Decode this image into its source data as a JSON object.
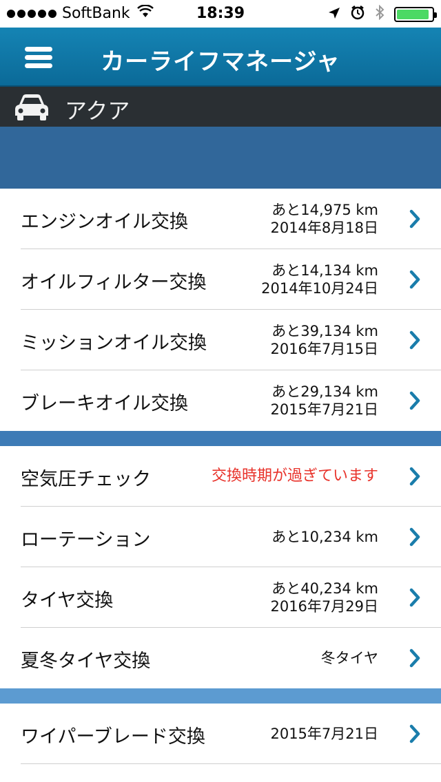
{
  "status": {
    "carrier": "SoftBank",
    "time": "18:39"
  },
  "header": {
    "title": "カーライフマネージャ"
  },
  "car": {
    "name": "アクア"
  },
  "colors": {
    "nav": "#1178a8",
    "car_bar": "#2a2f33",
    "banner": "#31679a",
    "section2": "#3d7bb6",
    "section3": "#5c9bd1",
    "chevron": "#1a7dab",
    "warning": "#e8322a"
  },
  "items": [
    {
      "label": "エンジンオイル交換",
      "line1": "あと14,975 km",
      "line2": "2014年8月18日"
    },
    {
      "label": "オイルフィルター交換",
      "line1": "あと14,134 km",
      "line2": "2014年10月24日"
    },
    {
      "label": "ミッションオイル交換",
      "line1": "あと39,134 km",
      "line2": "2016年7月15日"
    },
    {
      "label": "ブレーキオイル交換",
      "line1": "あと29,134 km",
      "line2": "2015年7月21日"
    },
    {
      "label": "空気圧チェック",
      "warning": "交換時期が過ぎています"
    },
    {
      "label": "ローテーション",
      "line1": "あと10,234 km"
    },
    {
      "label": "タイヤ交換",
      "line1": "あと40,234 km",
      "line2": "2016年7月29日"
    },
    {
      "label": "夏冬タイヤ交換",
      "line1": "冬タイヤ"
    },
    {
      "label": "ワイパーブレード交換",
      "line1": "2015年7月21日"
    }
  ]
}
